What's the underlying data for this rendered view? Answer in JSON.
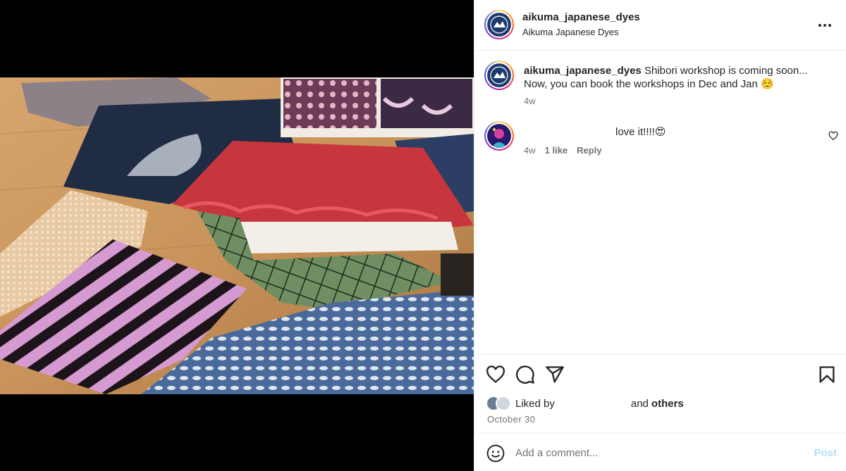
{
  "post": {
    "author_username": "aikuma_japanese_dyes",
    "author_subtitle": "Aikuma Japanese Dyes",
    "caption_username": "aikuma_japanese_dyes",
    "caption_text": "Shibori workshop is coming soon... Now, you can book the workshops in Dec and Jan ☺️",
    "caption_time": "4w",
    "image_description_icon": "photo-of-shibori-dyed-fabrics"
  },
  "comments": [
    {
      "text": "love it!!!!😍",
      "time": "4w",
      "likes": "1 like",
      "reply_label": "Reply"
    }
  ],
  "likes": {
    "prefix": "Liked by",
    "suffix": "and",
    "others": "others"
  },
  "date": "October 30",
  "add_comment": {
    "placeholder": "Add a comment...",
    "post_label": "Post"
  },
  "icons": {
    "more": "more-horizontal-icon",
    "heart": "heart-icon",
    "comment": "comment-bubble-icon",
    "share": "paper-plane-icon",
    "save": "bookmark-icon",
    "emoji": "emoji-smile-icon"
  },
  "colors": {
    "accent": "#0095f6",
    "post_disabled": "#b2dffc",
    "muted": "#737373",
    "text": "#262626"
  }
}
